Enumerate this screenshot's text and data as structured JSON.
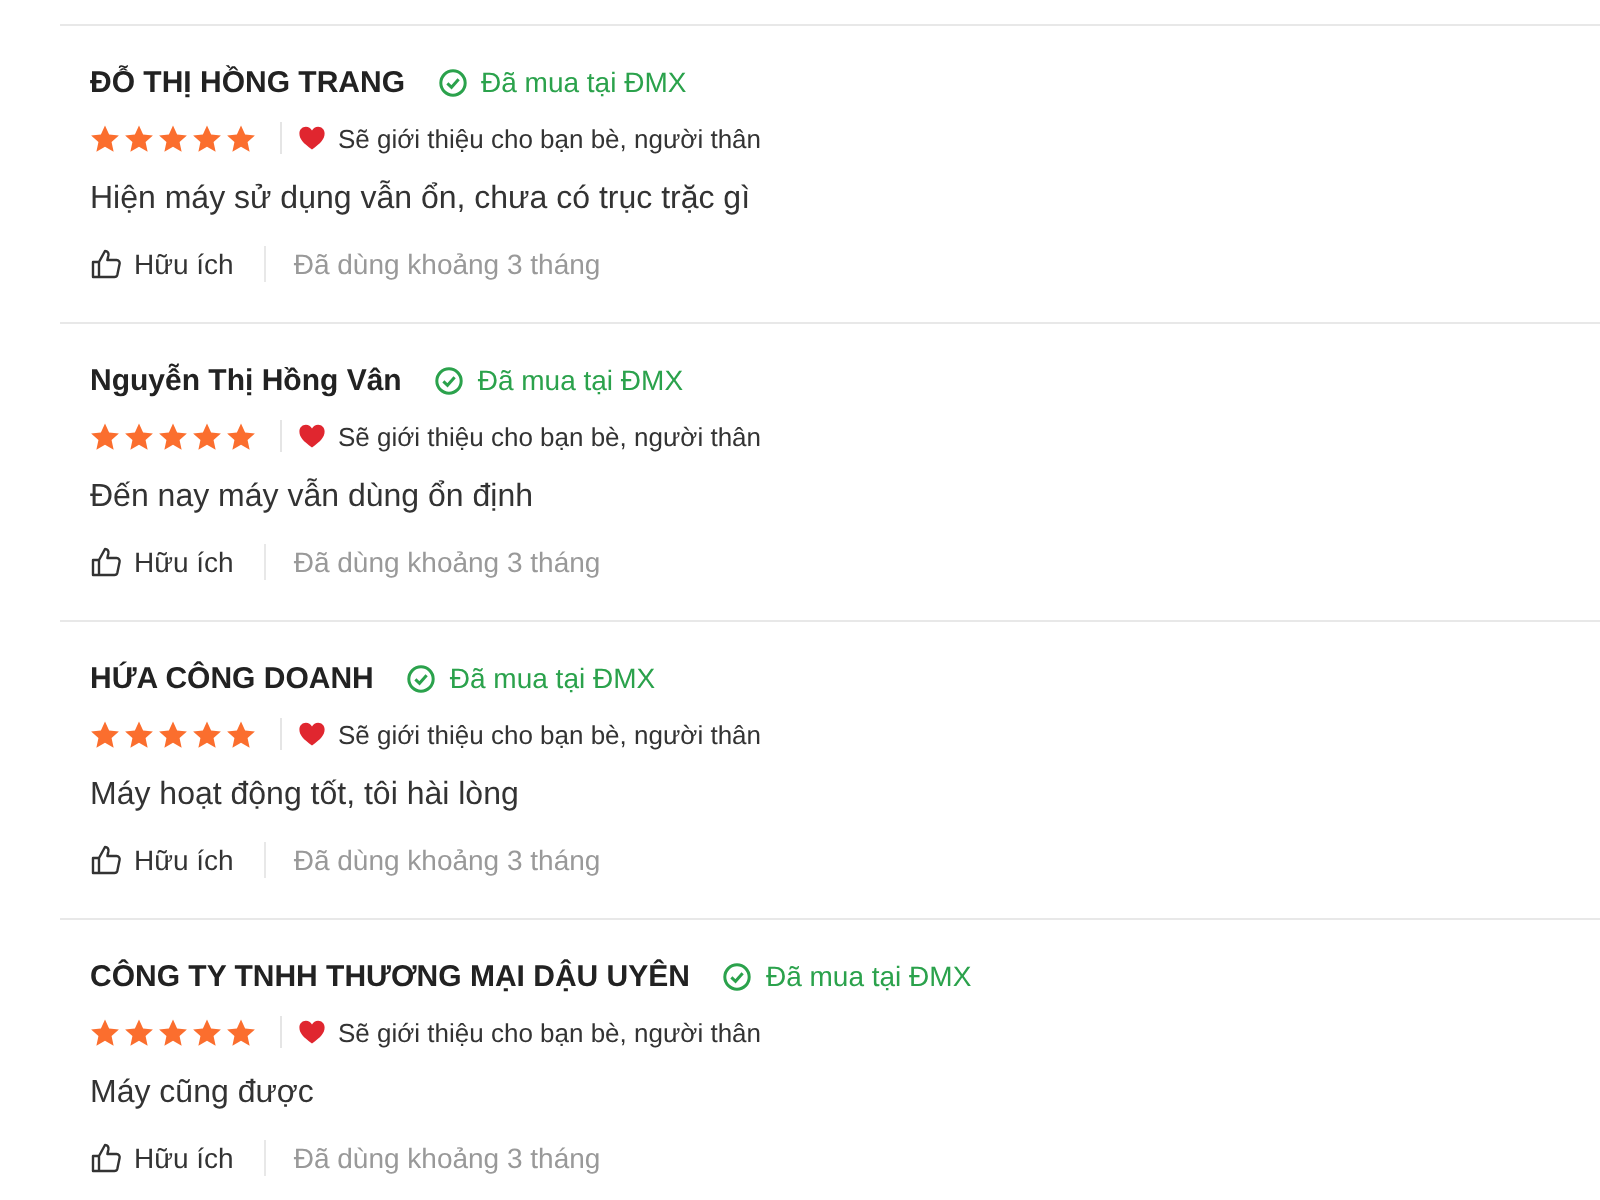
{
  "reviews": [
    {
      "name": "ĐỖ THỊ HỒNG TRANG",
      "verified": "Đã mua tại ĐMX",
      "stars": 5,
      "recommended": true,
      "recommend_text": "Sẽ giới thiệu cho bạn bè, người thân",
      "comment": "Hiện máy sử dụng vẫn ổn, chưa có trục trặc gì",
      "helpful": "Hữu ích",
      "usage": "Đã dùng khoảng 3 tháng"
    },
    {
      "name": "Nguyễn Thị Hồng Vân",
      "verified": "Đã mua tại ĐMX",
      "stars": 5,
      "recommended": true,
      "recommend_text": "Sẽ giới thiệu cho bạn bè, người thân",
      "comment": "Đến nay máy vẫn dùng ổn định",
      "helpful": "Hữu ích",
      "usage": "Đã dùng khoảng 3 tháng"
    },
    {
      "name": "HỨA CÔNG DOANH",
      "verified": "Đã mua tại ĐMX",
      "stars": 5,
      "recommended": true,
      "recommend_text": "Sẽ giới thiệu cho bạn bè, người thân",
      "comment": "Máy hoạt động tốt, tôi hài lòng",
      "helpful": "Hữu ích",
      "usage": "Đã dùng khoảng 3 tháng"
    },
    {
      "name": "CÔNG TY TNHH THƯƠNG MẠI DẬU UYÊN",
      "verified": "Đã mua tại ĐMX",
      "stars": 5,
      "recommended": true,
      "recommend_text": "Sẽ giới thiệu cho bạn bè, người thân",
      "comment": "Máy cũng được",
      "helpful": "Hữu ích",
      "usage": "Đã dùng khoảng 3 tháng"
    }
  ]
}
